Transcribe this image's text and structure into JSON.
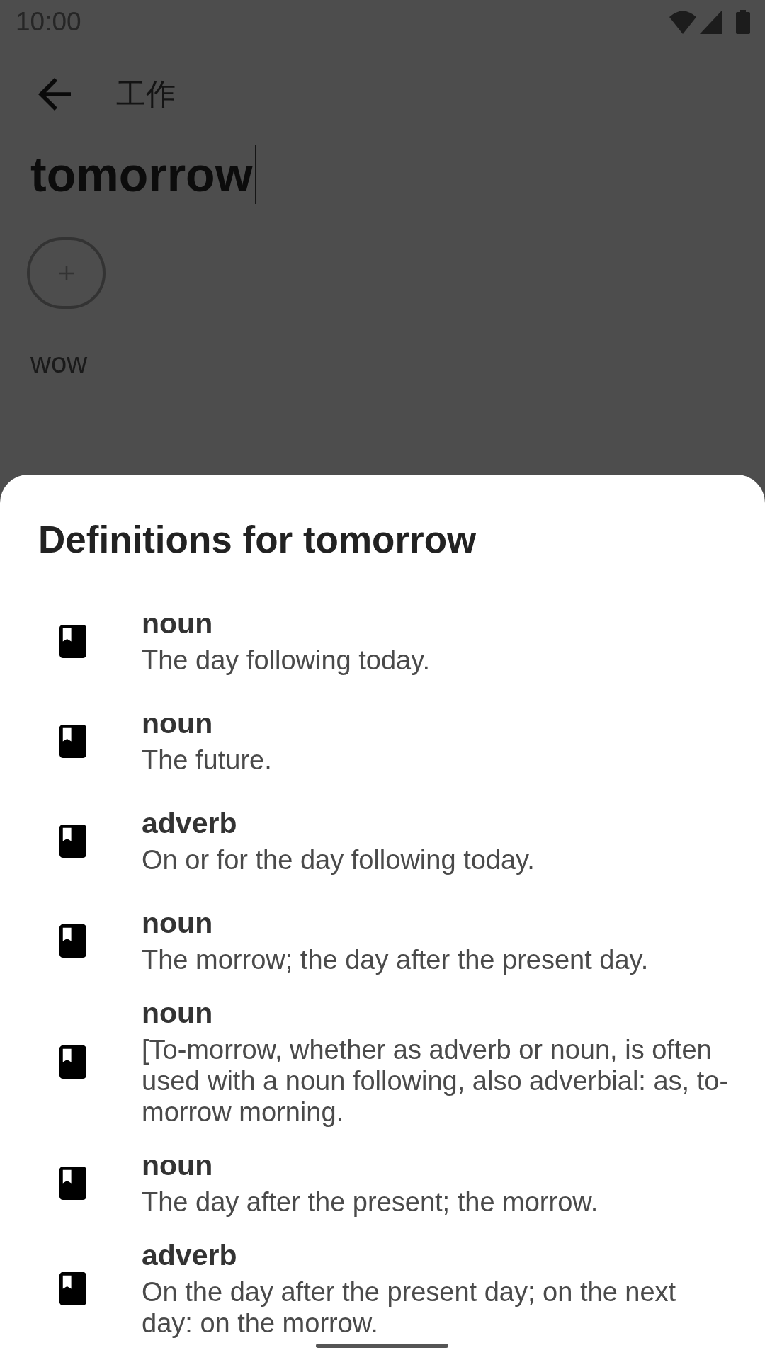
{
  "status_bar": {
    "time": "10:00"
  },
  "toolbar": {
    "title": "工作"
  },
  "word_field": {
    "value": "tomorrow",
    "focused": true
  },
  "note": {
    "text": "wow"
  },
  "definitions_sheet": {
    "title": "Definitions for tomorrow",
    "definitions": [
      {
        "part_of_speech": "noun",
        "text": "The day following today."
      },
      {
        "part_of_speech": "noun",
        "text": "The future."
      },
      {
        "part_of_speech": "adverb",
        "text": "On or for the day following today."
      },
      {
        "part_of_speech": "noun",
        "text": "The morrow; the day after the present day."
      },
      {
        "part_of_speech": "noun",
        "text": "[To-morrow, whether as adverb or noun, is often used with a noun following, also adverbial: as, to-morrow morning."
      },
      {
        "part_of_speech": "noun",
        "text": "The day after the present; the morrow."
      },
      {
        "part_of_speech": "adverb",
        "text": "On the day after the present day; on the next day: on the morrow."
      }
    ]
  }
}
